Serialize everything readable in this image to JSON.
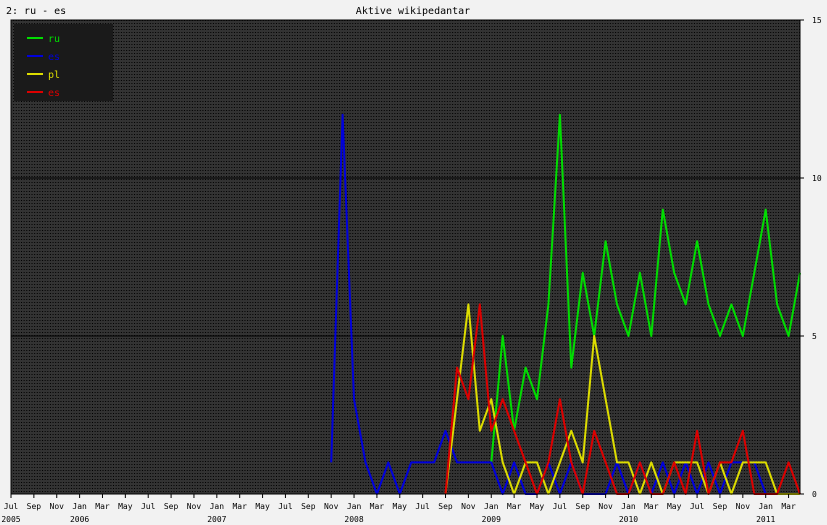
{
  "chart_data": {
    "type": "line",
    "panel_label": "2: ru - es",
    "title": "Aktive wikipedantar",
    "y_axis": {
      "range": [
        0,
        15
      ],
      "ticks": [
        0,
        5,
        10,
        15
      ],
      "major_grid": [
        5,
        10
      ]
    },
    "x_axis": {
      "range": [
        "2005-07",
        "2011-04"
      ],
      "month_labels": [
        "Jul",
        "Sep",
        "Nov",
        "Jan",
        "Mar",
        "May",
        "Jul",
        "Sep",
        "Nov",
        "Jan",
        "Mar",
        "May",
        "Jul",
        "Sep",
        "Nov",
        "Jan",
        "Mar",
        "May",
        "Jul",
        "Sep",
        "Nov",
        "Jan",
        "Mar",
        "May",
        "Jul",
        "Sep",
        "Nov",
        "Jan",
        "Mar",
        "May",
        "Jul",
        "Sep",
        "Nov",
        "Jan",
        "Mar"
      ],
      "year_labels": [
        "2005",
        "2006",
        "2007",
        "2008",
        "2009",
        "2010",
        "2011"
      ]
    },
    "background": "#333333",
    "grid": "dotted-vertical-weekly",
    "legend_position": "top-left",
    "legend_background": "#1a1a1a",
    "series": [
      {
        "name": "ru",
        "color": "#00dd00",
        "points": [
          [
            "2009-01",
            1
          ],
          [
            "2009-02",
            5
          ],
          [
            "2009-03",
            2
          ],
          [
            "2009-04",
            4
          ],
          [
            "2009-05",
            3
          ],
          [
            "2009-06",
            6
          ],
          [
            "2009-07",
            12
          ],
          [
            "2009-08",
            4
          ],
          [
            "2009-09",
            7
          ],
          [
            "2009-10",
            5
          ],
          [
            "2009-11",
            8
          ],
          [
            "2009-12",
            6
          ],
          [
            "2010-01",
            5
          ],
          [
            "2010-02",
            7
          ],
          [
            "2010-03",
            5
          ],
          [
            "2010-04",
            9
          ],
          [
            "2010-05",
            7
          ],
          [
            "2010-06",
            6
          ],
          [
            "2010-07",
            8
          ],
          [
            "2010-08",
            6
          ],
          [
            "2010-09",
            5
          ],
          [
            "2010-10",
            6
          ],
          [
            "2010-11",
            5
          ],
          [
            "2010-12",
            7
          ],
          [
            "2011-01",
            9
          ],
          [
            "2011-02",
            6
          ],
          [
            "2011-03",
            5
          ],
          [
            "2011-04",
            7
          ]
        ]
      },
      {
        "name": "es",
        "color": "#0000dd",
        "points": [
          [
            "2007-11",
            1
          ],
          [
            "2007-12",
            12
          ],
          [
            "2008-01",
            3
          ],
          [
            "2008-02",
            1
          ],
          [
            "2008-03",
            0
          ],
          [
            "2008-04",
            1
          ],
          [
            "2008-05",
            0
          ],
          [
            "2008-06",
            1
          ],
          [
            "2008-07",
            1
          ],
          [
            "2008-08",
            1
          ],
          [
            "2008-09",
            2
          ],
          [
            "2008-10",
            1
          ],
          [
            "2008-11",
            1
          ],
          [
            "2008-12",
            1
          ],
          [
            "2009-01",
            1
          ],
          [
            "2009-02",
            0
          ],
          [
            "2009-03",
            1
          ],
          [
            "2009-04",
            0
          ],
          [
            "2009-05",
            0
          ],
          [
            "2009-06",
            1
          ],
          [
            "2009-07",
            0
          ],
          [
            "2009-08",
            1
          ],
          [
            "2009-09",
            0
          ],
          [
            "2009-10",
            0
          ],
          [
            "2009-11",
            0
          ],
          [
            "2009-12",
            1
          ],
          [
            "2010-01",
            0
          ],
          [
            "2010-02",
            1
          ],
          [
            "2010-03",
            0
          ],
          [
            "2010-04",
            1
          ],
          [
            "2010-05",
            0
          ],
          [
            "2010-06",
            1
          ],
          [
            "2010-07",
            0
          ],
          [
            "2010-08",
            1
          ],
          [
            "2010-09",
            0
          ],
          [
            "2010-10",
            1
          ],
          [
            "2010-11",
            1
          ],
          [
            "2010-12",
            1
          ],
          [
            "2011-01",
            0
          ],
          [
            "2011-02",
            0
          ],
          [
            "2011-03",
            0
          ],
          [
            "2011-04",
            0
          ]
        ]
      },
      {
        "name": "pl",
        "color": "#dddd00",
        "points": [
          [
            "2008-09",
            0
          ],
          [
            "2008-10",
            3
          ],
          [
            "2008-11",
            6
          ],
          [
            "2008-12",
            2
          ],
          [
            "2009-01",
            3
          ],
          [
            "2009-02",
            1
          ],
          [
            "2009-03",
            0
          ],
          [
            "2009-04",
            1
          ],
          [
            "2009-05",
            1
          ],
          [
            "2009-06",
            0
          ],
          [
            "2009-07",
            1
          ],
          [
            "2009-08",
            2
          ],
          [
            "2009-09",
            1
          ],
          [
            "2009-10",
            5
          ],
          [
            "2009-11",
            3
          ],
          [
            "2009-12",
            1
          ],
          [
            "2010-01",
            1
          ],
          [
            "2010-02",
            0
          ],
          [
            "2010-03",
            1
          ],
          [
            "2010-04",
            0
          ],
          [
            "2010-05",
            1
          ],
          [
            "2010-06",
            1
          ],
          [
            "2010-07",
            1
          ],
          [
            "2010-08",
            0
          ],
          [
            "2010-09",
            1
          ],
          [
            "2010-10",
            0
          ],
          [
            "2010-11",
            1
          ],
          [
            "2010-12",
            1
          ],
          [
            "2011-01",
            1
          ],
          [
            "2011-02",
            0
          ],
          [
            "2011-03",
            0
          ],
          [
            "2011-04",
            0
          ]
        ]
      },
      {
        "name": "es",
        "color": "#dd0000",
        "points": [
          [
            "2008-09",
            0
          ],
          [
            "2008-10",
            4
          ],
          [
            "2008-11",
            3
          ],
          [
            "2008-12",
            6
          ],
          [
            "2009-01",
            2
          ],
          [
            "2009-02",
            3
          ],
          [
            "2009-03",
            2
          ],
          [
            "2009-04",
            1
          ],
          [
            "2009-05",
            0
          ],
          [
            "2009-06",
            1
          ],
          [
            "2009-07",
            3
          ],
          [
            "2009-08",
            1
          ],
          [
            "2009-09",
            0
          ],
          [
            "2009-10",
            2
          ],
          [
            "2009-11",
            1
          ],
          [
            "2009-12",
            0
          ],
          [
            "2010-01",
            0
          ],
          [
            "2010-02",
            1
          ],
          [
            "2010-03",
            0
          ],
          [
            "2010-04",
            0
          ],
          [
            "2010-05",
            1
          ],
          [
            "2010-06",
            0
          ],
          [
            "2010-07",
            2
          ],
          [
            "2010-08",
            0
          ],
          [
            "2010-09",
            1
          ],
          [
            "2010-10",
            1
          ],
          [
            "2010-11",
            2
          ],
          [
            "2010-12",
            0
          ],
          [
            "2011-01",
            0
          ],
          [
            "2011-02",
            0
          ],
          [
            "2011-03",
            1
          ],
          [
            "2011-04",
            0
          ]
        ]
      }
    ]
  }
}
